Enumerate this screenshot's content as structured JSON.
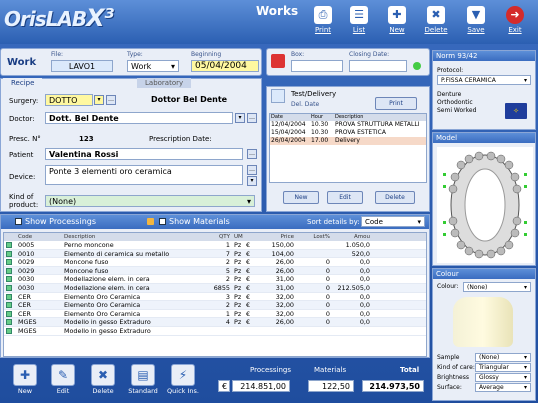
{
  "app": {
    "logo": "OrisLAB",
    "logo_suffix": "X³",
    "title": "Works"
  },
  "toolbar": [
    {
      "label": "Print",
      "icon": "printer-icon",
      "glyph": "⎙"
    },
    {
      "label": "List",
      "icon": "list-icon",
      "glyph": "☰"
    },
    {
      "label": "New",
      "icon": "new-icon",
      "glyph": "✚"
    },
    {
      "label": "Delete",
      "icon": "delete-icon",
      "glyph": "✖"
    },
    {
      "label": "Save",
      "icon": "save-icon",
      "glyph": "▼"
    },
    {
      "label": "Exit",
      "icon": "exit-icon",
      "glyph": "➜"
    }
  ],
  "work": {
    "title": "Work",
    "file_label": "File:",
    "file_value": "LAVO1",
    "type_label": "Type:",
    "type_value": "Work",
    "beginning_label": "Beginning",
    "beginning_value": "05/04/2004"
  },
  "box": {
    "box_label": "Box:",
    "box_value": "",
    "closing_label": "Closing Date:",
    "closing_value": ""
  },
  "recipe": {
    "tab_recipe": "Recipe",
    "tab_laboratory": "Laboratory",
    "surgery_label": "Surgery:",
    "surgery_code": "DOTTO",
    "surgery_name": "Dottor Bel Dente",
    "doctor_label": "Doctor:",
    "doctor_value": "Dott. Bel Dente",
    "presc_label": "Presc. N°",
    "presc_value": "123",
    "presc_date_label": "Prescription Date:",
    "presc_date_value": "",
    "patient_label": "Patient",
    "patient_value": "Valentina Rossi",
    "device_label": "Device:",
    "device_value": "Ponte 3 elementi oro ceramica",
    "kind_label": "Kind of product:",
    "kind_value": "(None)"
  },
  "testdelivery": {
    "title": "Test/Delivery",
    "del_date_label": "Del. Date",
    "print_label": "Print",
    "headers": [
      "Date",
      "Hour",
      "Description"
    ],
    "rows": [
      {
        "date": "12/04/2004",
        "hour": "10.30",
        "desc": "PROVA STRUTTURA METALLI"
      },
      {
        "date": "15/04/2004",
        "hour": "10.30",
        "desc": "PROVA ESTETICA"
      },
      {
        "date": "26/04/2004",
        "hour": "17.00",
        "desc": "Delivery"
      }
    ],
    "new_label": "New",
    "edit_label": "Edit",
    "delete_label": "Delete"
  },
  "processings": {
    "show_processings": "Show Processings",
    "show_materials": "Show Materials",
    "sort_label": "Sort details by:",
    "sort_value": "Code",
    "headers": [
      "",
      "Code",
      "Description",
      "QTY",
      "UM",
      "",
      "Price",
      "Lost%",
      "Amou"
    ],
    "rows": [
      {
        "code": "0005",
        "desc": "Perno moncone",
        "qty": "1",
        "um": "Pz",
        "cur": "€",
        "price": "150,00",
        "lost": "",
        "amount": "1.050,0"
      },
      {
        "code": "0010",
        "desc": "Elemento di ceramica su metallo",
        "qty": "7",
        "um": "Pz",
        "cur": "€",
        "price": "104,00",
        "lost": "",
        "amount": "520,0"
      },
      {
        "code": "0029",
        "desc": "Moncone fuso",
        "qty": "2",
        "um": "Pz",
        "cur": "€",
        "price": "26,00",
        "lost": "0",
        "amount": "0,0"
      },
      {
        "code": "0029",
        "desc": "Moncone fuso",
        "qty": "5",
        "um": "Pz",
        "cur": "€",
        "price": "26,00",
        "lost": "0",
        "amount": "0,0"
      },
      {
        "code": "0030",
        "desc": "Modellazione elem. in cera",
        "qty": "2",
        "um": "Pz",
        "cur": "€",
        "price": "31,00",
        "lost": "0",
        "amount": "0,0"
      },
      {
        "code": "0030",
        "desc": "Modellazione elem. in cera",
        "qty": "6855",
        "um": "Pz",
        "cur": "€",
        "price": "31,00",
        "lost": "0",
        "amount": "212.505,0"
      },
      {
        "code": "CER",
        "desc": "Elemento Oro Ceramica",
        "qty": "3",
        "um": "Pz",
        "cur": "€",
        "price": "32,00",
        "lost": "0",
        "amount": "0,0"
      },
      {
        "code": "CER",
        "desc": "Elemento Oro Ceramica",
        "qty": "2",
        "um": "Pz",
        "cur": "€",
        "price": "32,00",
        "lost": "0",
        "amount": "0,0"
      },
      {
        "code": "CER",
        "desc": "Elemento Oro Ceramica",
        "qty": "1",
        "um": "Pz",
        "cur": "€",
        "price": "32,00",
        "lost": "0",
        "amount": "0,0"
      },
      {
        "code": "MGES",
        "desc": "Modello in gesso Extraduro",
        "qty": "4",
        "um": "Pz",
        "cur": "€",
        "price": "26,00",
        "lost": "0",
        "amount": "0,0"
      },
      {
        "code": "MGES",
        "desc": "Modello in gesso Extraduro",
        "qty": "",
        "um": "",
        "cur": "",
        "price": "",
        "lost": "",
        "amount": ""
      }
    ]
  },
  "bottom": [
    {
      "label": "New",
      "icon": "new-icon",
      "glyph": "✚"
    },
    {
      "label": "Edit",
      "icon": "edit-icon",
      "glyph": "✎"
    },
    {
      "label": "Delete",
      "icon": "delete-icon",
      "glyph": "✖"
    },
    {
      "label": "Standard",
      "icon": "standard-icon",
      "glyph": "▤"
    },
    {
      "label": "Quick Ins.",
      "icon": "quick-insert-icon",
      "glyph": "⚡"
    }
  ],
  "totals": {
    "currency": "€",
    "processings_label": "Processings",
    "processings_value": "214.851,00",
    "materials_label": "Materials",
    "materials_value": "122,50",
    "total_label": "Total",
    "total_value": "214.973,50"
  },
  "norm": {
    "title": "Norm 93/42",
    "protocol_label": "Protocol:",
    "protocol_value": "P.FISSA CERAMICA",
    "items": [
      "Denture",
      "Orthodontic",
      "Semi Worked"
    ]
  },
  "model": {
    "title": "Model"
  },
  "colour": {
    "title": "Colour",
    "colour_label": "Colour:",
    "colour_value": "(None)",
    "sample_label": "Sample",
    "sample_value": "(None)",
    "kind_label": "Kind of care:",
    "kind_value": "Triangular",
    "brightness_label": "Brightness",
    "brightness_value": "Glossy",
    "surface_label": "Surface:",
    "surface_value": "Average"
  }
}
